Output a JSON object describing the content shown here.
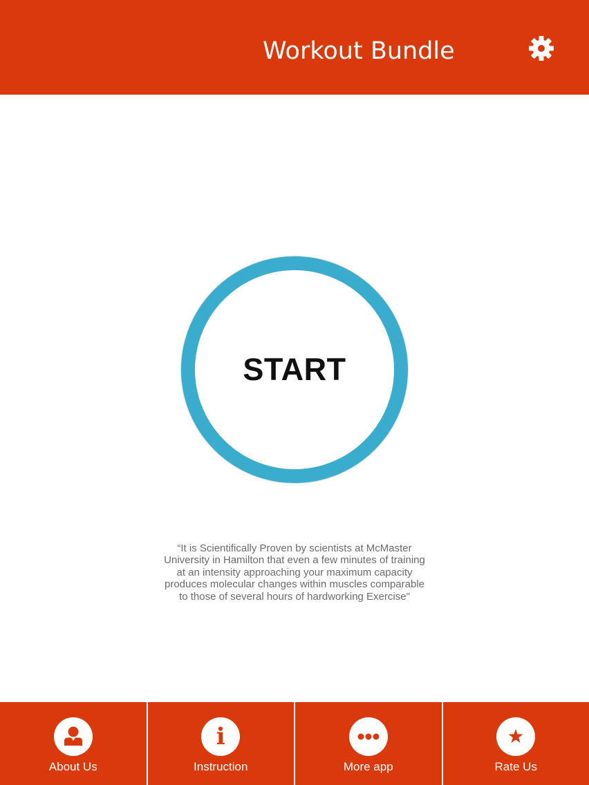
{
  "header": {
    "title": "Workout Bundle",
    "settings_icon": "gear-icon"
  },
  "main": {
    "start_label": "START",
    "ring_color": "#3aaccd",
    "quote_lines": [
      "“It is Scientifically Proven by scientists at McMaster",
      "University in Hamilton that even a few minutes of training",
      "at an intensity approaching your maximum capacity",
      "produces molecular changes within muscles comparable",
      "to those of several hours of hardworking Exercise\""
    ]
  },
  "tabs": [
    {
      "label": "About Us",
      "icon": "user-icon"
    },
    {
      "label": "Instruction",
      "icon": "info-icon"
    },
    {
      "label": "More app",
      "icon": "more-dots-icon"
    },
    {
      "label": "Rate Us",
      "icon": "star-icon"
    }
  ],
  "colors": {
    "brand": "#d9390b",
    "accent": "#3aaccd"
  }
}
